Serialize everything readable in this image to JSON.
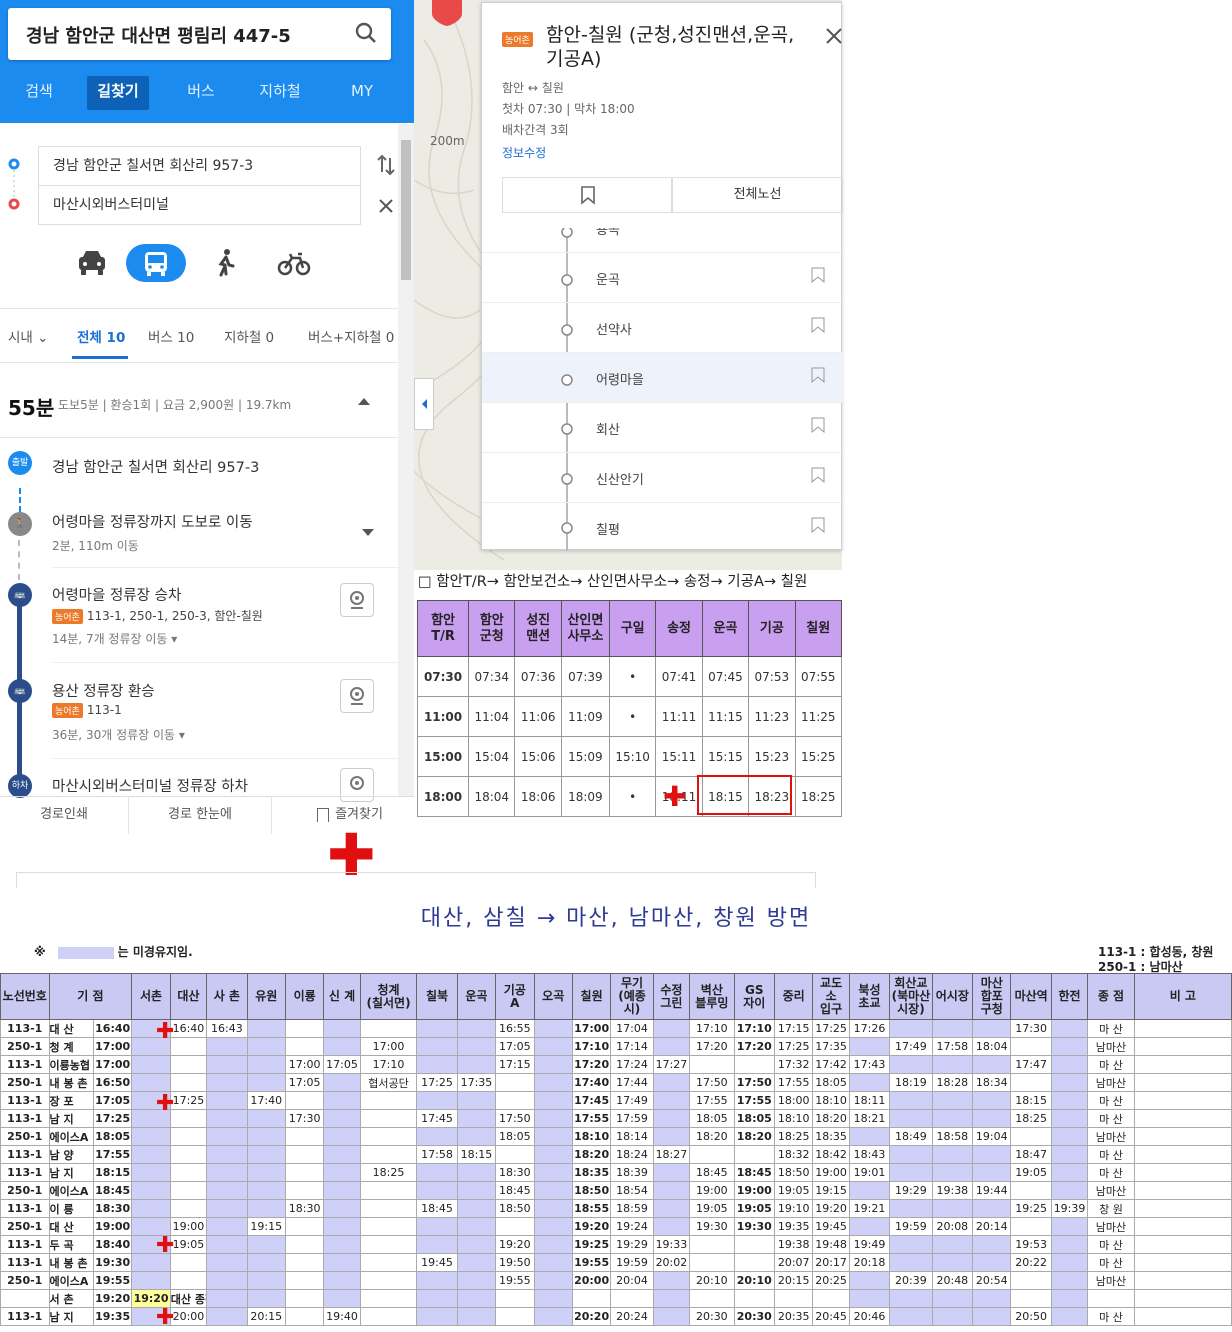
{
  "search": {
    "query": "경남 함안군 대산면 평림리 447-5"
  },
  "nav": {
    "tabs": [
      "검색",
      "길찾기",
      "버스",
      "지하철",
      "MY"
    ]
  },
  "route": {
    "origin": "경남 함안군 칠서면 회산리 957-3",
    "destination": "마산시외버스터미널"
  },
  "filters": {
    "t1": "시내",
    "t2": "전체",
    "t2n": "10",
    "t3": "버스 10",
    "t4": "지하철 0",
    "t5": "버스+지하철 0"
  },
  "summary": {
    "time": "55분",
    "detail": "도보5분 | 환승1회 | 요금 2,900원 | 19.7km"
  },
  "steps": {
    "start_badge": "출발",
    "start": "경남 함안군 칠서면 회산리 957-3",
    "walk": "어령마을 정류장까지 도보로 이동",
    "walk_sub": "2분, 110m 이동",
    "board": "어령마을 정류장 승차",
    "board_tag": "농어촌",
    "board_lines": "113-1,  250-1,  250-3,  함안-칠원",
    "board_sub": "14분, 7개 정류장 이동",
    "transfer": "용산 정류장 환승",
    "transfer_tag": "농어촌",
    "transfer_lines": "113-1",
    "transfer_sub": "36분, 30개 정류장 이동",
    "end_badge": "하차",
    "end": "마산시외버스터미널 정류장 하차"
  },
  "bottombar": {
    "print": "경로인쇄",
    "overview": "경로 한눈에",
    "fav": "즐겨찾기"
  },
  "map": {
    "scale": "200m"
  },
  "popup": {
    "tag": "농어촌",
    "title": "함안-칠원 (군청,성진맨션,운곡,기공A)",
    "from": "함안",
    "to": "칠원",
    "first": "첫차 07:30",
    "last": "막차 18:00",
    "interval": "배차간격 3회",
    "edit": "정보수정",
    "allroutes": "전체노선",
    "stops": [
      "용곡",
      "운곡",
      "선약사",
      "어령마을",
      "회산",
      "신산안기",
      "칠평"
    ]
  },
  "routeline": "□ 함안T/R→ 함안보건소→ 산인면사무소→ 송정→ 기공A→ 칠원",
  "route_table": {
    "headers": [
      "함안\nT/R",
      "함안\n군청",
      "성진\n맨션",
      "산인면\n사무소",
      "구일",
      "송정",
      "운곡",
      "기공",
      "칠원"
    ],
    "rows": [
      [
        "07:30",
        "07:34",
        "07:36",
        "07:39",
        "•",
        "07:41",
        "07:45",
        "07:53",
        "07:55"
      ],
      [
        "11:00",
        "11:04",
        "11:06",
        "11:09",
        "•",
        "11:11",
        "11:15",
        "11:23",
        "11:25"
      ],
      [
        "15:00",
        "15:04",
        "15:06",
        "15:09",
        "15:10",
        "15:11",
        "15:15",
        "15:23",
        "15:25"
      ],
      [
        "18:00",
        "18:04",
        "18:06",
        "18:09",
        "•",
        "18:11",
        "18:15",
        "18:23",
        "18:25"
      ]
    ]
  },
  "timetable": {
    "title": "대산, 삼칠 → 마산, 남마산, 창원 방면",
    "legend": "는 미경유지임.",
    "legend_mark": "※",
    "note1": "113-1 : 합성동, 창원",
    "note2": "250-1 : 남마산",
    "headers": [
      "노선번호",
      "기 점",
      "",
      "서촌",
      "대산",
      "사 촌",
      "유원",
      "이룡",
      "신 계",
      "청계\n(칠서면)",
      "칠북",
      "운곡",
      "기공\nA",
      "오곡",
      "칠원",
      "무기\n(예종시)",
      "수정\n그린",
      "벽산\n블루밍",
      "GS\n자이",
      "중리",
      "교도\n소\n입구",
      "북성\n초교",
      "회산교\n(북마산\n시장)",
      "어시장",
      "마산\n합포\n구청",
      "마산역",
      "한전",
      "종 점",
      "비 고"
    ],
    "rows": [
      [
        "113-1",
        "대      산",
        "16:40",
        "",
        "16:40",
        "16:43",
        "",
        "",
        "",
        "",
        "",
        "",
        "16:55",
        "",
        "17:00",
        "17:04",
        "",
        "17:10",
        "17:10",
        "17:15",
        "17:25",
        "17:26",
        "",
        "",
        "",
        "17:30",
        "",
        "마  산",
        ""
      ],
      [
        "250-1",
        "청      계",
        "17:00",
        "",
        "",
        "",
        "",
        "",
        "",
        "17:00",
        "",
        "",
        "17:05",
        "",
        "17:10",
        "17:14",
        "",
        "17:20",
        "17:20",
        "17:25",
        "17:35",
        "",
        "17:49",
        "17:58",
        "18:04",
        "",
        "",
        "남마산",
        ""
      ],
      [
        "113-1",
        "이룡농협",
        "17:00",
        "",
        "",
        "",
        "",
        "17:00",
        "17:05",
        "17:10",
        "",
        "",
        "17:15",
        "",
        "17:20",
        "17:24",
        "17:27",
        "",
        "",
        "17:32",
        "17:42",
        "17:43",
        "",
        "",
        "",
        "17:47",
        "",
        "마  산",
        ""
      ],
      [
        "250-1",
        "내 봉 촌",
        "16:50",
        "",
        "",
        "",
        "",
        "17:05",
        "",
        "협서공단",
        "17:25",
        "17:35",
        "",
        "",
        "17:40",
        "17:44",
        "",
        "17:50",
        "17:50",
        "17:55",
        "18:05",
        "",
        "18:19",
        "18:28",
        "18:34",
        "",
        "",
        "남마산",
        ""
      ],
      [
        "113-1",
        "장      포",
        "17:05",
        "",
        "17:25",
        "",
        "17:40",
        "",
        "",
        "",
        "",
        "",
        "",
        "",
        "17:45",
        "17:49",
        "",
        "17:55",
        "17:55",
        "18:00",
        "18:10",
        "18:11",
        "",
        "",
        "",
        "18:15",
        "",
        "마  산",
        ""
      ],
      [
        "113-1",
        "남      지",
        "17:25",
        "",
        "",
        "",
        "",
        "17:30",
        "",
        "",
        "17:45",
        "",
        "17:50",
        "",
        "17:55",
        "17:59",
        "",
        "18:05",
        "18:05",
        "18:10",
        "18:20",
        "18:21",
        "",
        "",
        "",
        "18:25",
        "",
        "마  산",
        ""
      ],
      [
        "250-1",
        "에이스A",
        "18:05",
        "",
        "",
        "",
        "",
        "",
        "",
        "",
        "",
        "",
        "18:05",
        "",
        "18:10",
        "18:14",
        "",
        "18:20",
        "18:20",
        "18:25",
        "18:35",
        "",
        "18:49",
        "18:58",
        "19:04",
        "",
        "",
        "남마산",
        ""
      ],
      [
        "113-1",
        "남      양",
        "17:55",
        "",
        "",
        "",
        "",
        "",
        "",
        "",
        "17:58",
        "18:15",
        "",
        "",
        "18:20",
        "18:24",
        "18:27",
        "",
        "",
        "18:32",
        "18:42",
        "18:43",
        "",
        "",
        "",
        "18:47",
        "",
        "마  산",
        ""
      ],
      [
        "113-1",
        "남      지",
        "18:15",
        "",
        "",
        "",
        "",
        "",
        "",
        "18:25",
        "",
        "",
        "18:30",
        "",
        "18:35",
        "18:39",
        "",
        "18:45",
        "18:45",
        "18:50",
        "19:00",
        "19:01",
        "",
        "",
        "",
        "19:05",
        "",
        "마  산",
        ""
      ],
      [
        "250-1",
        "에이스A",
        "18:45",
        "",
        "",
        "",
        "",
        "",
        "",
        "",
        "",
        "",
        "18:45",
        "",
        "18:50",
        "18:54",
        "",
        "19:00",
        "19:00",
        "19:05",
        "19:15",
        "",
        "19:29",
        "19:38",
        "19:44",
        "",
        "",
        "남마산",
        ""
      ],
      [
        "113-1",
        "이      룡",
        "18:30",
        "",
        "",
        "",
        "",
        "18:30",
        "",
        "",
        "18:45",
        "",
        "18:50",
        "",
        "18:55",
        "18:59",
        "",
        "19:05",
        "19:05",
        "19:10",
        "19:20",
        "19:21",
        "",
        "",
        "",
        "19:25",
        "19:39",
        "창  원",
        ""
      ],
      [
        "250-1",
        "대      산",
        "19:00",
        "",
        "19:00",
        "",
        "19:15",
        "",
        "",
        "",
        "",
        "",
        "",
        "",
        "19:20",
        "19:24",
        "",
        "19:30",
        "19:30",
        "19:35",
        "19:45",
        "",
        "19:59",
        "20:08",
        "20:14",
        "",
        "",
        "남마산",
        ""
      ],
      [
        "113-1",
        "두      곡",
        "18:40",
        "",
        "19:05",
        "",
        "",
        "",
        "",
        "",
        "",
        "",
        "19:20",
        "",
        "19:25",
        "19:29",
        "19:33",
        "",
        "",
        "19:38",
        "19:48",
        "19:49",
        "",
        "",
        "",
        "19:53",
        "",
        "마  산",
        ""
      ],
      [
        "113-1",
        "내 봉 촌",
        "19:30",
        "",
        "",
        "",
        "",
        "",
        "",
        "",
        "19:45",
        "",
        "19:50",
        "",
        "19:55",
        "19:59",
        "20:02",
        "",
        "",
        "20:07",
        "20:17",
        "20:18",
        "",
        "",
        "",
        "20:22",
        "",
        "마  산",
        ""
      ],
      [
        "250-1",
        "에이스A",
        "19:55",
        "",
        "",
        "",
        "",
        "",
        "",
        "",
        "",
        "",
        "19:55",
        "",
        "20:00",
        "20:04",
        "",
        "20:10",
        "20:10",
        "20:15",
        "20:25",
        "",
        "20:39",
        "20:48",
        "20:54",
        "",
        "",
        "남마산",
        ""
      ],
      [
        "",
        "서      촌",
        "19:20",
        "19:20",
        "대산 종점",
        "",
        "",
        "",
        "",
        "",
        "",
        "",
        "",
        "",
        "",
        "",
        "",
        "",
        "",
        "",
        "",
        "",
        "",
        "",
        "",
        "",
        "",
        "",
        ""
      ],
      [
        "113-1",
        "남      지",
        "19:35",
        "",
        "20:00",
        "",
        "20:15",
        "",
        "19:40",
        "",
        "",
        "",
        "",
        "",
        "20:20",
        "20:24",
        "",
        "20:30",
        "20:30",
        "20:35",
        "20:45",
        "20:46",
        "",
        "",
        "",
        "20:50",
        "",
        "마  산",
        ""
      ]
    ]
  }
}
